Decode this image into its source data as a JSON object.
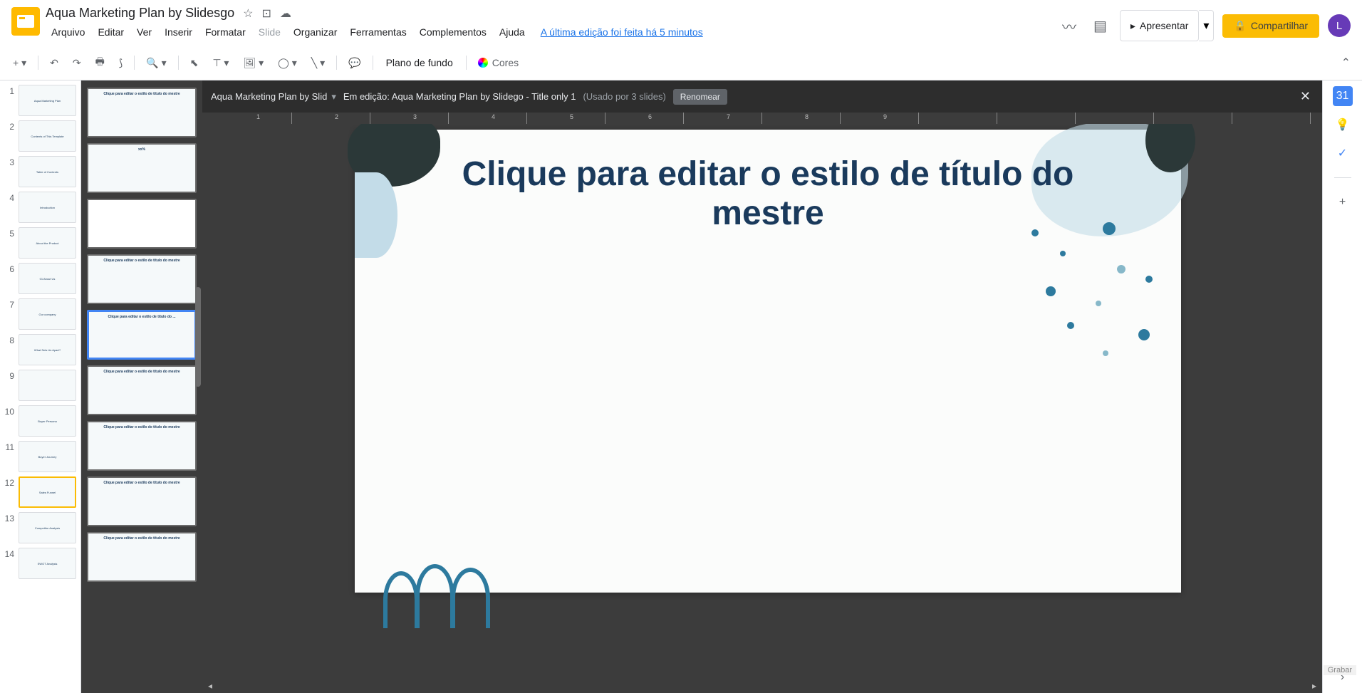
{
  "doc_title": "Aqua Marketing Plan by Slidesgo",
  "menus": {
    "arquivo": "Arquivo",
    "editar": "Editar",
    "ver": "Ver",
    "inserir": "Inserir",
    "formatar": "Formatar",
    "slide": "Slide",
    "organizar": "Organizar",
    "ferramentas": "Ferramentas",
    "complementos": "Complementos",
    "ajuda": "Ajuda"
  },
  "last_edit": "A última edição foi feita há 5 minutos",
  "present": "Apresentar",
  "share": "Compartilhar",
  "avatar_letter": "L",
  "toolbar": {
    "bg": "Plano de fundo",
    "colors": "Cores"
  },
  "master_bar": {
    "breadcrumb": "Aqua Marketing Plan by Slid",
    "editing": "Em edição: Aqua Marketing Plan by Slidego - Title only 1",
    "usage": "(Usado por 3 slides)",
    "rename": "Renomear"
  },
  "slide_title": "Clique para editar o estilo de título do mestre",
  "ruler_ticks": [
    "1",
    "2",
    "3",
    "4",
    "5",
    "6",
    "7",
    "8",
    "9"
  ],
  "slides": [
    {
      "n": "1",
      "label": "Aqua Marketing Plan"
    },
    {
      "n": "2",
      "label": "Contents of This Template"
    },
    {
      "n": "3",
      "label": "Table of Contents"
    },
    {
      "n": "4",
      "label": "Introduction"
    },
    {
      "n": "5",
      "label": "About the Product"
    },
    {
      "n": "6",
      "label": "01 About Us"
    },
    {
      "n": "7",
      "label": "Our company"
    },
    {
      "n": "8",
      "label": "What Sets Us Apart?"
    },
    {
      "n": "9",
      "label": ""
    },
    {
      "n": "10",
      "label": "Buyer Persona"
    },
    {
      "n": "11",
      "label": "Buyer Journey"
    },
    {
      "n": "12",
      "label": "Sales Funnel",
      "selected": true
    },
    {
      "n": "13",
      "label": "Competitor Analysis"
    },
    {
      "n": "14",
      "label": "SWOT Analysis"
    }
  ],
  "layouts": [
    {
      "label": "Clique para editar o estilo de título do mestre"
    },
    {
      "label": "xx%"
    },
    {
      "label": "",
      "blank": true
    },
    {
      "label": "Clique para editar o estilo de título do mestre"
    },
    {
      "label": "Clique para editar o estilo de título do ...",
      "selected": true
    },
    {
      "label": "Clique para editar o estilo de título do mestre"
    },
    {
      "label": "Clique para editar o estilo de título do mestre"
    },
    {
      "label": "Clique para editar o estilo de título do mestre"
    },
    {
      "label": "Clique para editar o estilo de título do mestre"
    }
  ],
  "grabar": "Grabar"
}
